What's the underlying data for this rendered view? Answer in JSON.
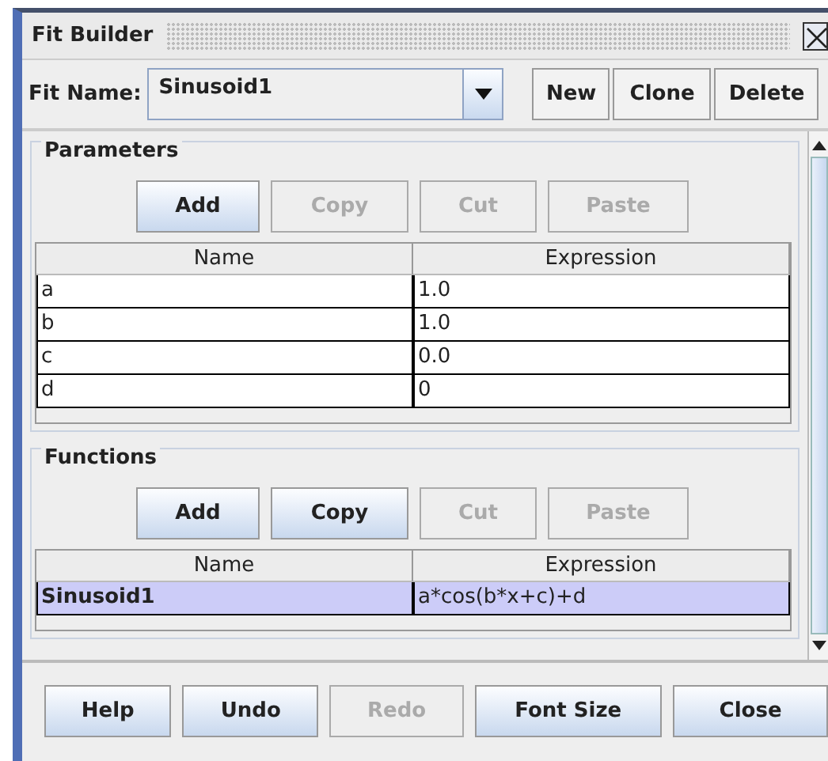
{
  "window": {
    "title": "Fit Builder"
  },
  "fit_name": {
    "label": "Fit Name:",
    "value": "Sinusoid1"
  },
  "top_buttons": [
    {
      "label": "New",
      "disabled": false
    },
    {
      "label": "Clone",
      "disabled": false
    },
    {
      "label": "Delete",
      "disabled": false
    }
  ],
  "groups": [
    {
      "title": "Parameters",
      "buttons": [
        {
          "label": "Add",
          "disabled": false
        },
        {
          "label": "Copy",
          "disabled": true
        },
        {
          "label": "Cut",
          "disabled": true
        },
        {
          "label": "Paste",
          "disabled": true
        }
      ],
      "columns": [
        "Name",
        "Expression"
      ],
      "rows": [
        {
          "cells": [
            "a",
            "1.0"
          ],
          "selected": false
        },
        {
          "cells": [
            "b",
            "1.0"
          ],
          "selected": false
        },
        {
          "cells": [
            "c",
            "0.0"
          ],
          "selected": false
        },
        {
          "cells": [
            "d",
            "0"
          ],
          "selected": false
        }
      ]
    },
    {
      "title": "Functions",
      "buttons": [
        {
          "label": "Add",
          "disabled": false
        },
        {
          "label": "Copy",
          "disabled": false
        },
        {
          "label": "Cut",
          "disabled": true
        },
        {
          "label": "Paste",
          "disabled": true
        }
      ],
      "columns": [
        "Name",
        "Expression"
      ],
      "rows": [
        {
          "cells": [
            "Sinusoid1",
            "a*cos(b*x+c)+d"
          ],
          "selected": true
        }
      ]
    }
  ],
  "bottom_buttons": [
    {
      "label": "Help",
      "disabled": false
    },
    {
      "label": "Undo",
      "disabled": false
    },
    {
      "label": "Redo",
      "disabled": true
    },
    {
      "label": "Font Size",
      "disabled": false
    },
    {
      "label": "Close",
      "disabled": false
    }
  ]
}
